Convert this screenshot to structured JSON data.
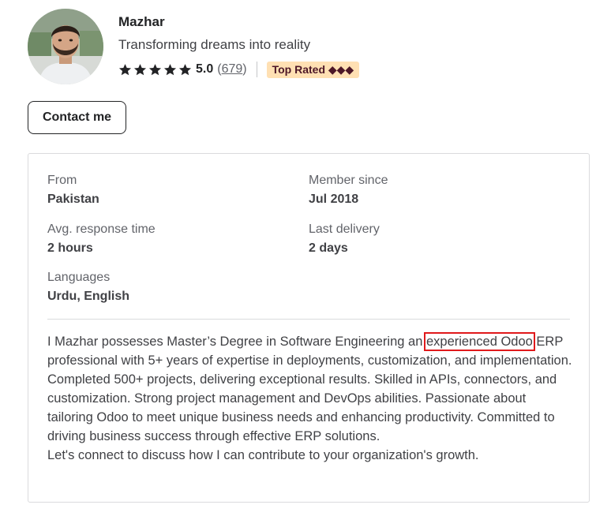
{
  "profile": {
    "name": "Mazhar",
    "tagline": "Transforming dreams into reality",
    "rating": {
      "stars": 5,
      "score": "5.0",
      "reviews": "679"
    },
    "badge": "Top Rated ◆◆◆",
    "contact_label": "Contact me"
  },
  "stats": {
    "from": {
      "label": "From",
      "value": "Pakistan"
    },
    "member_since": {
      "label": "Member since",
      "value": "Jul 2018"
    },
    "response_time": {
      "label": "Avg. response time",
      "value": "2 hours"
    },
    "last_delivery": {
      "label": "Last delivery",
      "value": "2 days"
    },
    "languages": {
      "label": "Languages",
      "value": "Urdu, English"
    }
  },
  "description": {
    "part1": "I Mazhar possesses Master’s Degree in Software Engineering an ",
    "highlight": "experienced Odoo",
    "part2": " ERP professional with 5+ years of expertise in deployments, customization, and implementation. Completed 500+ projects, delivering exceptional results. Skilled in APIs, connectors, and customization. Strong project management and DevOps abilities. Passionate about tailoring Odoo to meet unique business needs and enhancing productivity. Committed to driving business success through effective ERP solutions.",
    "closing": "Let's connect to discuss how I can contribute to your organization's growth."
  },
  "colors": {
    "highlight_box": "#e0191b",
    "badge_bg": "#ffe0b3",
    "star": "#222325"
  }
}
